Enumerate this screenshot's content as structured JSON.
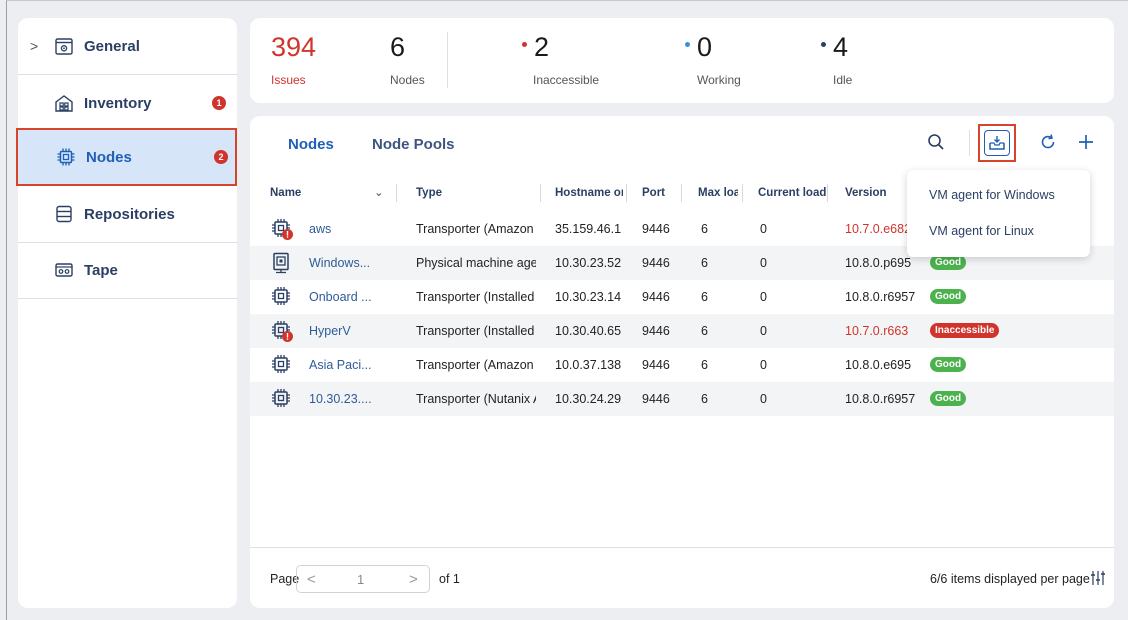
{
  "sidebar": {
    "items": [
      {
        "label": "General",
        "icon": "gear-box-icon",
        "chevron": ">"
      },
      {
        "label": "Inventory",
        "icon": "inventory-icon",
        "badge": "1"
      },
      {
        "label": "Nodes",
        "icon": "chip-icon",
        "badge": "2"
      },
      {
        "label": "Repositories",
        "icon": "repository-icon"
      },
      {
        "label": "Tape",
        "icon": "tape-icon"
      }
    ]
  },
  "summary": {
    "issues": {
      "value": "394",
      "label": "Issues"
    },
    "nodes": {
      "value": "6",
      "label": "Nodes"
    },
    "inaccessible": {
      "value": "2",
      "label": "Inaccessible"
    },
    "working": {
      "value": "0",
      "label": "Working"
    },
    "idle": {
      "value": "4",
      "label": "Idle"
    }
  },
  "tabs": [
    "Nodes",
    "Node Pools"
  ],
  "table": {
    "columns": [
      "Name",
      "Type",
      "Hostname or",
      "Port",
      "Max loa",
      "Current load",
      "Version"
    ],
    "rows": [
      {
        "name": "aws",
        "type": "Transporter (Amazon E",
        "host": "35.159.46.1",
        "port": "9446",
        "max": "6",
        "current": "0",
        "version": "10.7.0.e682",
        "version_red": true,
        "status": "",
        "icon": "chip-error-icon"
      },
      {
        "name": "Windows...",
        "type": "Physical machine age",
        "host": "10.30.23.52",
        "port": "9446",
        "max": "6",
        "current": "0",
        "version": "10.8.0.p695",
        "version_red": false,
        "status": "Good",
        "icon": "physical-machine-icon"
      },
      {
        "name": "Onboard ...",
        "type": "Transporter (Installed",
        "host": "10.30.23.14",
        "port": "9446",
        "max": "6",
        "current": "0",
        "version": "10.8.0.r6957",
        "version_red": false,
        "status": "Good",
        "icon": "chip-icon"
      },
      {
        "name": "HyperV",
        "type": "Transporter (Installed",
        "host": "10.30.40.65",
        "port": "9446",
        "max": "6",
        "current": "0",
        "version": "10.7.0.r663",
        "version_red": true,
        "status": "Inaccessible",
        "icon": "chip-error-icon"
      },
      {
        "name": "Asia Paci...",
        "type": "Transporter (Amazon E",
        "host": "10.0.37.138",
        "port": "9446",
        "max": "6",
        "current": "0",
        "version": "10.8.0.e695",
        "version_red": false,
        "status": "Good",
        "icon": "chip-icon"
      },
      {
        "name": "10.30.23....",
        "type": "Transporter (Nutanix A",
        "host": "10.30.24.29",
        "port": "9446",
        "max": "6",
        "current": "0",
        "version": "10.8.0.r6957",
        "version_red": false,
        "status": "Good",
        "icon": "chip-icon"
      }
    ]
  },
  "dropdown": {
    "items": [
      "VM agent for Windows",
      "VM agent for Linux"
    ]
  },
  "footer": {
    "page_label": "Page",
    "page_value": "1",
    "of_label": "of 1",
    "per_page": "6/6 items displayed per page"
  },
  "colors": {
    "accent": "#1f5fb8",
    "danger": "#d0342c",
    "good": "#4cb24e",
    "highlight_border": "#d8432c"
  }
}
